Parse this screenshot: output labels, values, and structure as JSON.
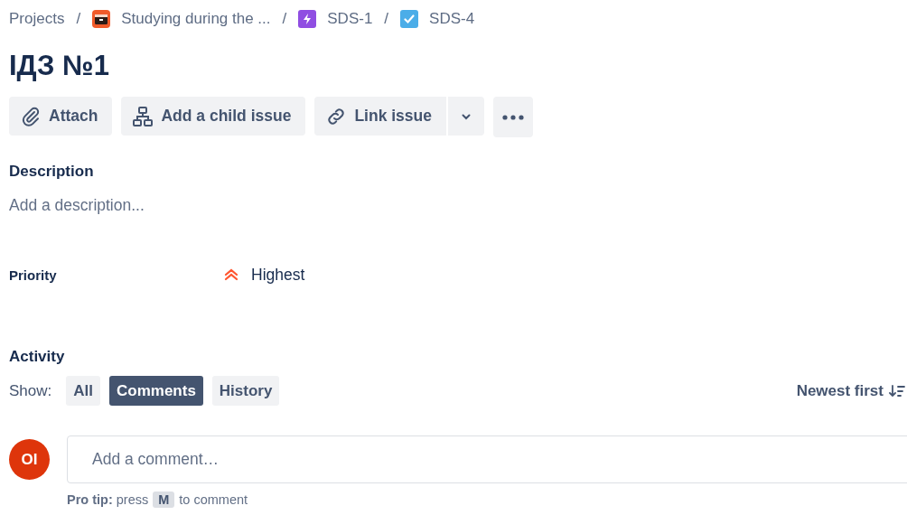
{
  "breadcrumb_separator": "/",
  "breadcrumbs": [
    {
      "label": "Projects",
      "kind": "root"
    },
    {
      "label": "Studying during the ...",
      "kind": "project"
    },
    {
      "label": "SDS-1",
      "kind": "epic"
    },
    {
      "label": "SDS-4",
      "kind": "task"
    }
  ],
  "title": "ІДЗ №1",
  "toolbar": [
    {
      "label": "Attach",
      "kind": "attach"
    },
    {
      "label": "Add a child issue",
      "kind": "child"
    },
    {
      "label": "Link issue",
      "kind": "link"
    }
  ],
  "description": {
    "heading": "Description",
    "placeholder": "Add a description..."
  },
  "priority": {
    "label": "Priority",
    "value": "Highest"
  },
  "activity": {
    "heading": "Activity",
    "show_label": "Show:",
    "filters": [
      {
        "label": "All",
        "selected": false
      },
      {
        "label": "Comments",
        "selected": true
      },
      {
        "label": "History",
        "selected": false
      }
    ],
    "sort": "Newest first"
  },
  "comment": {
    "avatar": "OI",
    "placeholder": "Add a comment…",
    "tip": "**Pro tip:** press",
    "key": "M",
    "tip_end": "to comment"
  }
}
